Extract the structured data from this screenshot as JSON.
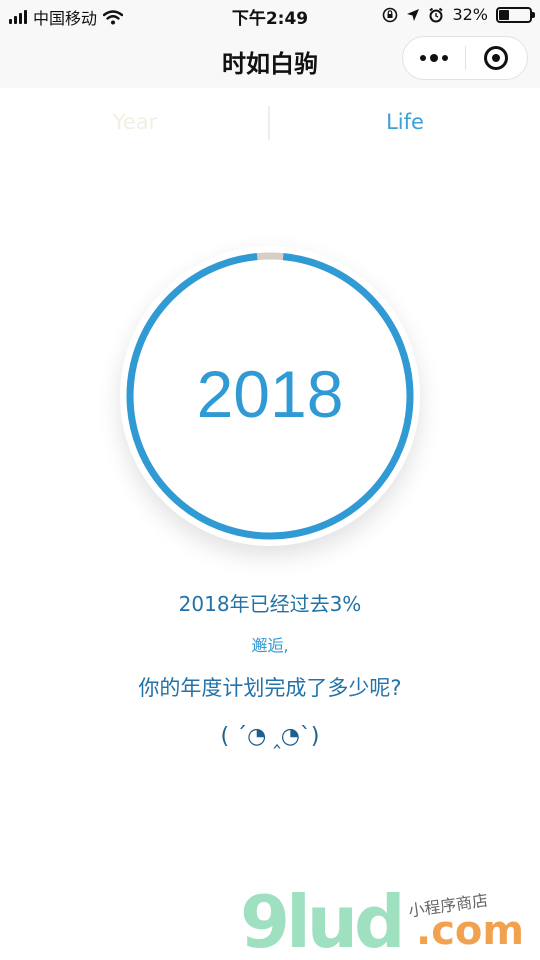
{
  "status_bar": {
    "carrier": "中国移动",
    "time": "下午2:49",
    "battery_percent": "32%",
    "battery_level": 0.32,
    "icons": [
      "signal-icon",
      "wifi-icon",
      "orientation-lock-icon",
      "location-arrow-icon",
      "alarm-icon",
      "battery-icon"
    ]
  },
  "nav": {
    "title": "时如白驹",
    "more_icon": "more-dots-icon",
    "close_icon": "target-close-icon"
  },
  "tabs": [
    {
      "label": "Year",
      "active": false
    },
    {
      "label": "Life",
      "active": true
    }
  ],
  "ring": {
    "year": "2018",
    "progress": 0.97,
    "colors": {
      "progress": "#2f9ad4",
      "remainder": "#d6cfc4"
    }
  },
  "texts": {
    "line1": "2018年已经过去3%",
    "line2": "邂逅,",
    "line3": "你的年度计划完成了多少呢?",
    "emoticon": "( ´◔ ‸◔`)"
  },
  "watermark": {
    "logo": "9lud",
    "domain": ".com",
    "subtitle": "小程序商店"
  }
}
